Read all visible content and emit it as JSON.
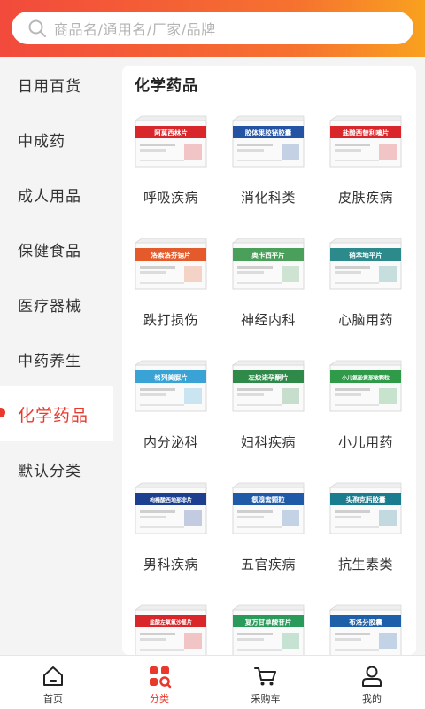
{
  "search": {
    "placeholder": "商品名/通用名/厂家/品牌"
  },
  "sidebar": {
    "items": [
      {
        "label": "日用百货"
      },
      {
        "label": "中成药"
      },
      {
        "label": "成人用品"
      },
      {
        "label": "保健食品"
      },
      {
        "label": "医疗器械"
      },
      {
        "label": "中药养生"
      },
      {
        "label": "化学药品",
        "active": true
      },
      {
        "label": "默认分类"
      }
    ]
  },
  "main": {
    "title": "化学药品",
    "categories": [
      {
        "label": "呼吸疾病",
        "box": "阿莫西林片",
        "color": "#d8262a"
      },
      {
        "label": "消化科类",
        "box": "胶体果胶铋胶囊",
        "color": "#2453a3"
      },
      {
        "label": "皮肤疾病",
        "box": "盐酸西替利嗪片",
        "color": "#d8262a"
      },
      {
        "label": "跌打损伤",
        "box": "洛索洛芬钠片",
        "color": "#e45a2b"
      },
      {
        "label": "神经内科",
        "box": "奥卡西平片",
        "color": "#4aa05a"
      },
      {
        "label": "心脑用药",
        "box": "硝苯地平片",
        "color": "#2c8a8c"
      },
      {
        "label": "内分泌科",
        "box": "格列美脲片",
        "color": "#3aa3d6"
      },
      {
        "label": "妇科疾病",
        "box": "左炔诺孕酮片",
        "color": "#2f8a4a"
      },
      {
        "label": "小儿用药",
        "box": "小儿氨酚黄那敏颗粒",
        "color": "#2f9a48"
      },
      {
        "label": "男科疾病",
        "box": "枸橼酸西地那非片",
        "color": "#1d3f8f"
      },
      {
        "label": "五官疾病",
        "box": "氨溴索颗粒",
        "color": "#1e5aa8"
      },
      {
        "label": "抗生素类",
        "box": "头孢克肟胶囊",
        "color": "#1a7d8f"
      },
      {
        "label": "",
        "box": "盐酸左氧氟沙星片",
        "color": "#d8262a"
      },
      {
        "label": "",
        "box": "复方甘草酸苷片",
        "color": "#2a9a5a"
      },
      {
        "label": "",
        "box": "布洛芬胶囊",
        "color": "#1d5fa8"
      }
    ]
  },
  "bottom_nav": {
    "items": [
      {
        "label": "首页",
        "icon": "home-icon"
      },
      {
        "label": "分类",
        "icon": "category-icon",
        "active": true
      },
      {
        "label": "采购车",
        "icon": "cart-icon"
      },
      {
        "label": "我的",
        "icon": "profile-icon"
      }
    ]
  },
  "colors": {
    "accent": "#e8392c",
    "header_start": "#f24a3c",
    "header_end": "#f9a11f"
  }
}
